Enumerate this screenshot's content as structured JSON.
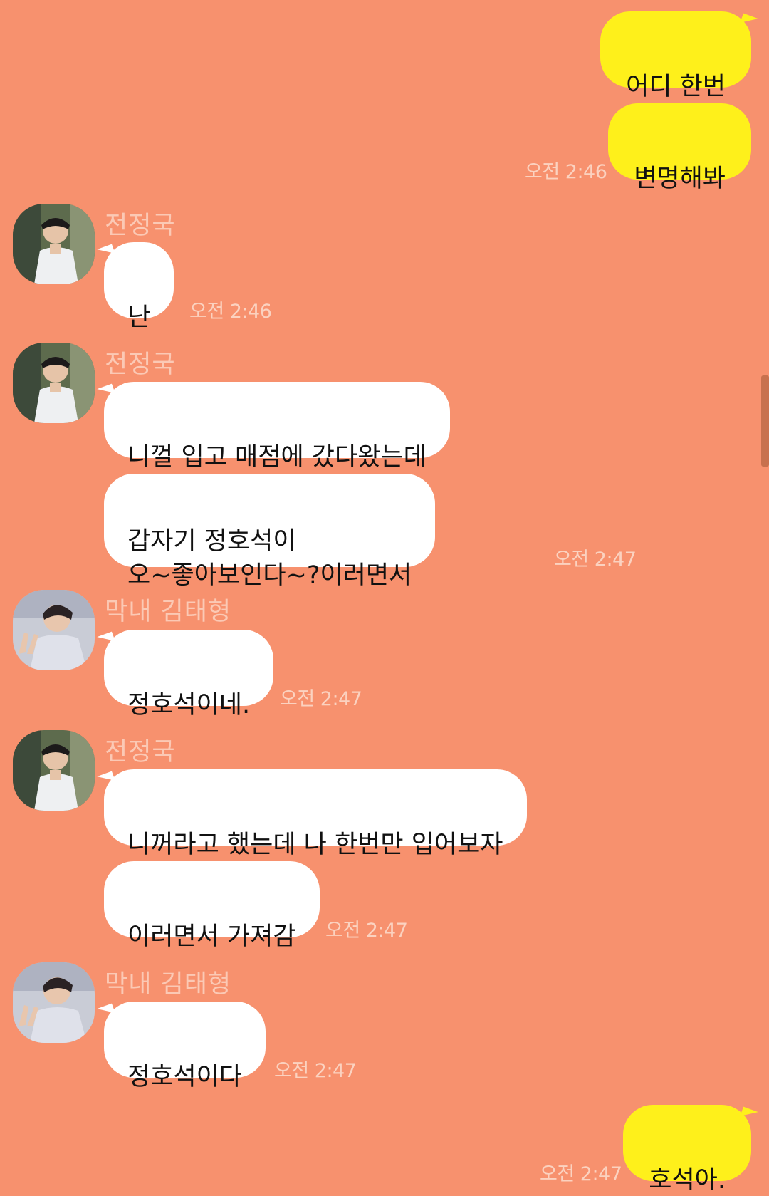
{
  "chat": {
    "sender_jungkook": "전정국",
    "sender_taehyung": "막내 김태형",
    "messages": [
      {
        "from": "me",
        "text": "어디 한번"
      },
      {
        "from": "me",
        "text": "변명해봐",
        "time": "오전 2:46"
      },
      {
        "from": "jungkook",
        "text": "난",
        "time": "오전 2:46"
      },
      {
        "from": "jungkook",
        "text": "니껄 입고 매점에 갔다왔는데"
      },
      {
        "from": "jungkook",
        "text": "갑자기 정호석이\n오~좋아보인다~?이러면서",
        "time": "오전 2:47"
      },
      {
        "from": "taehyung",
        "text": "정호석이네.",
        "time": "오전 2:47"
      },
      {
        "from": "jungkook",
        "text": "니꺼라고 했는데 나 한번만 입어보자"
      },
      {
        "from": "jungkook",
        "text": "이러면서 가져감",
        "time": "오전 2:47"
      },
      {
        "from": "taehyung",
        "text": "정호석이다",
        "time": "오전 2:47"
      },
      {
        "from": "me",
        "text": "호석아.",
        "time": "오전 2:47"
      }
    ]
  },
  "icons": {
    "avatar_jungkook": "profile-photo-icon",
    "avatar_taehyung": "profile-photo-icon"
  },
  "colors": {
    "background": "#f7916e",
    "my_bubble": "#fef01b",
    "their_bubble": "#ffffff",
    "timestamp": "#fbd2c0",
    "sender_name": "#fbc9b5"
  }
}
